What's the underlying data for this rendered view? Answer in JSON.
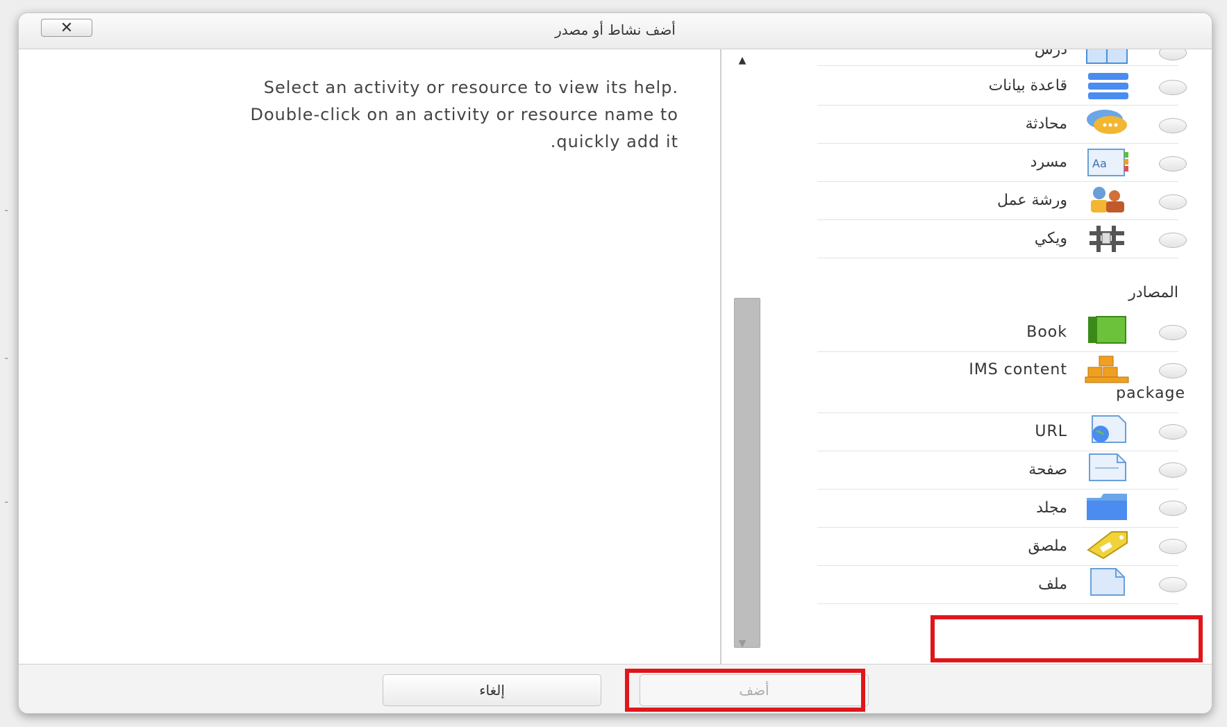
{
  "dialog": {
    "title": "أضف نشاط أو مصدر",
    "close_symbol": "✕"
  },
  "help": {
    "line1": "Select an activity or resource to view its help.",
    "line2": "Double-click on an activity or resource name to",
    "line3": ".quickly add it"
  },
  "activities": [
    {
      "label": "درس",
      "icon": "lesson-icon"
    },
    {
      "label": "قاعدة بيانات",
      "icon": "database-icon"
    },
    {
      "label": "محادثة",
      "icon": "chat-icon"
    },
    {
      "label": "مسرد",
      "icon": "glossary-icon"
    },
    {
      "label": "ورشة عمل",
      "icon": "workshop-icon"
    },
    {
      "label": "ويكي",
      "icon": "wiki-icon"
    }
  ],
  "resources_heading": "المصادر",
  "resources": [
    {
      "label": "Book",
      "icon": "book-icon"
    },
    {
      "label": "IMS content",
      "label2": "package",
      "icon": "ims-package-icon"
    },
    {
      "label": "URL",
      "icon": "url-icon"
    },
    {
      "label": "صفحة",
      "icon": "page-icon"
    },
    {
      "label": "مجلد",
      "icon": "folder-icon"
    },
    {
      "label": "ملصق",
      "icon": "label-icon"
    },
    {
      "label": "ملف",
      "icon": "file-icon"
    }
  ],
  "footer": {
    "cancel_label": "إلغاء",
    "add_label": "أضف"
  },
  "colors": {
    "highlight": "#e0161b",
    "scroll_thumb": "#bdbdbd"
  }
}
